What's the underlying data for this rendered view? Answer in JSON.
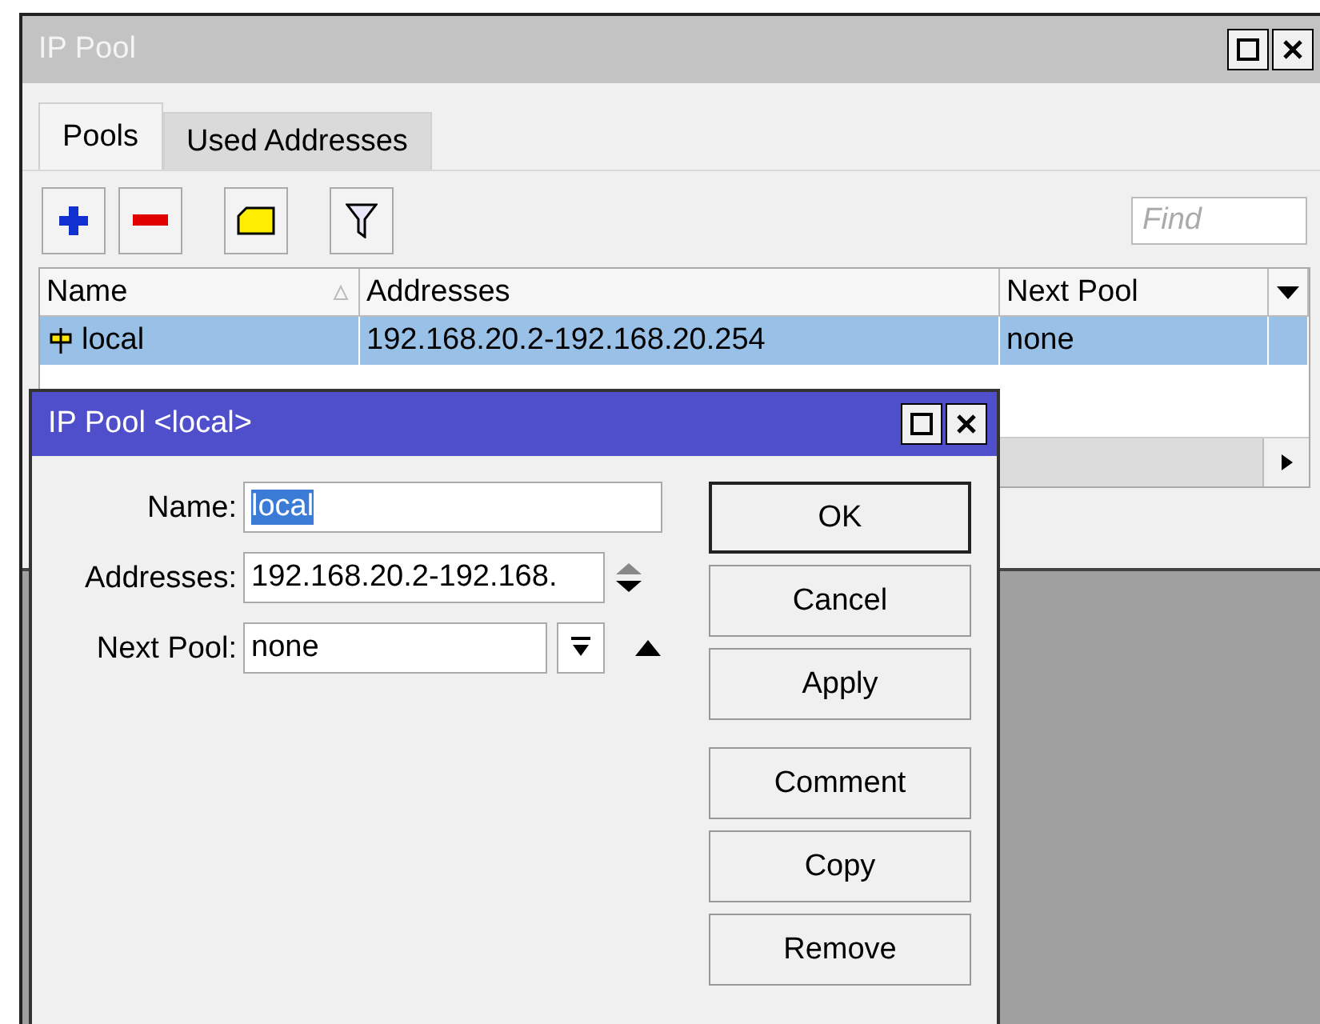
{
  "main_window": {
    "title": "IP Pool",
    "tabs": [
      {
        "label": "Pools",
        "selected": true
      },
      {
        "label": "Used Addresses",
        "selected": false
      }
    ],
    "search": {
      "placeholder": "Find"
    },
    "table": {
      "columns": [
        "Name",
        "Addresses",
        "Next Pool"
      ],
      "rows": [
        {
          "cells": [
            "local",
            "192.168.20.2-192.168.20.254",
            "none"
          ],
          "selected": true
        }
      ]
    }
  },
  "dialog": {
    "title": "IP Pool <local>",
    "fields": [
      {
        "label": "Name:",
        "value": "local",
        "kind": "text",
        "text_selected": true
      },
      {
        "label": "Addresses:",
        "value": "192.168.20.2-192.168.",
        "kind": "range",
        "text_selected": false
      },
      {
        "label": "Next Pool:",
        "value": "none",
        "kind": "dropdown",
        "text_selected": false
      }
    ],
    "buttons": [
      {
        "label": "OK",
        "default": true
      },
      {
        "label": "Cancel",
        "default": false
      },
      {
        "label": "Apply",
        "default": false
      },
      {
        "label": "Comment",
        "default": false
      },
      {
        "label": "Copy",
        "default": false
      },
      {
        "label": "Remove",
        "default": false
      }
    ]
  }
}
